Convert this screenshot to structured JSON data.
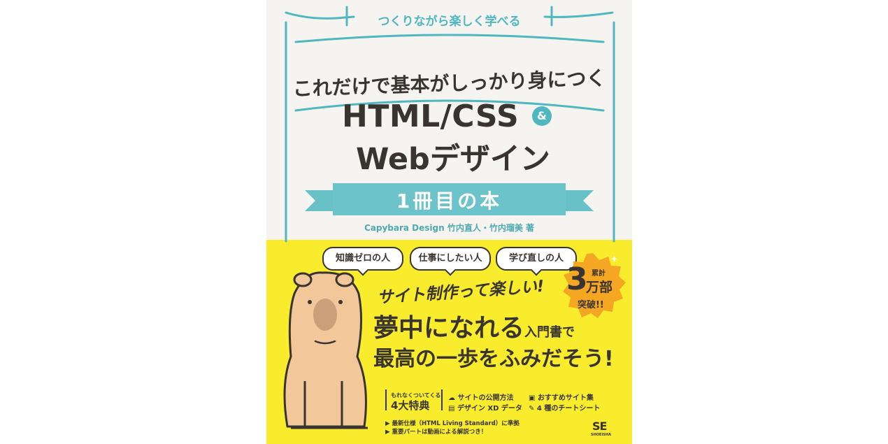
{
  "cover": {
    "tagline": "つくりながら楽しく学べる",
    "subtitle": "これだけで基本がしっかり身につく",
    "title_line1": "HTML/CSS",
    "title_amp": "&",
    "title_line2": "Webデザイン",
    "ribbon": "1冊目の本",
    "authors": "Capybara Design 竹内直人・竹内瑠美 著",
    "bubbles": [
      "知識ゼロの人",
      "仕事にしたい人",
      "学び直しの人"
    ],
    "handwritten": "サイト制作って楽しい!",
    "headline_main": "夢中になれる",
    "headline_small": "入門書で",
    "headline_line2": "最高の一歩をふみだそう!",
    "badge": {
      "prefix": "累計",
      "number": "3",
      "unit": "万部",
      "suffix": "突破!!"
    },
    "perks_label_small": "もれなくついてくる",
    "perks_label": "4大特典",
    "perks": [
      "サイトの公開方法",
      "おすすめサイト集",
      "デザイン XD データ",
      "4 種のチートシート"
    ],
    "notes": [
      "▶ 最新仕様（HTML Living Standard）に準拠",
      "▶ 重要パートは動画による解説つき！"
    ],
    "publisher_logo": "SE",
    "publisher_name": "SHOEISHA",
    "colors": {
      "teal": "#4fb7bf",
      "yellow": "#f8ec2d",
      "orange": "#f5a623",
      "ink": "#3a3431",
      "capybara": "#f2c79a"
    }
  }
}
